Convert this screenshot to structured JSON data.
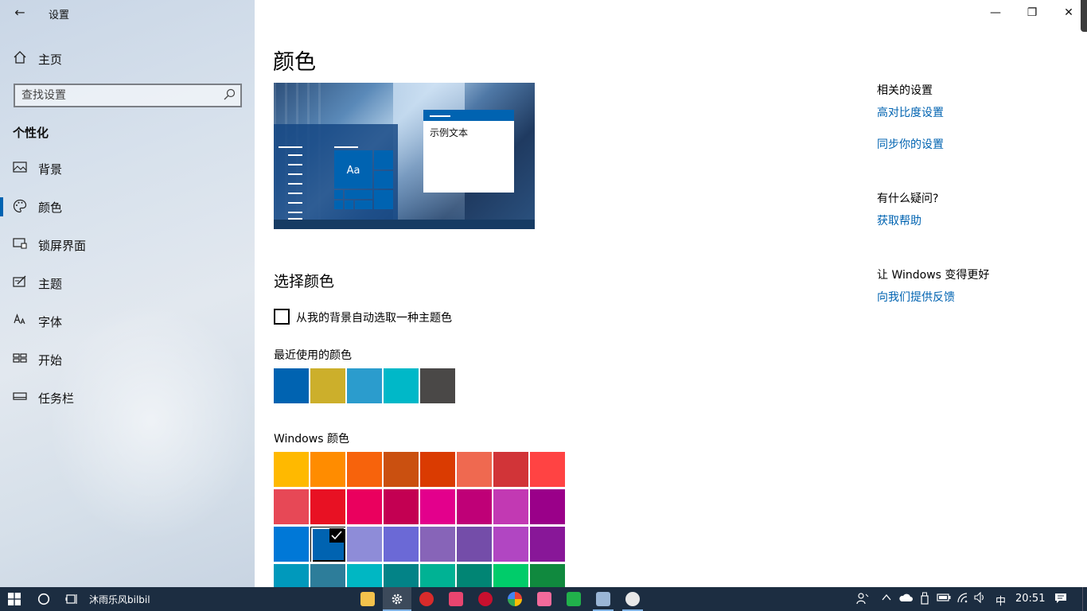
{
  "window": {
    "title": "设置",
    "back_glyph": "←",
    "minimize_glyph": "—",
    "restore_glyph": "❐",
    "close_glyph": "✕"
  },
  "sidebar": {
    "home_label": "主页",
    "search_placeholder": "查找设置",
    "section_title": "个性化",
    "items": [
      {
        "label": "背景",
        "icon": "image-icon",
        "selected": false
      },
      {
        "label": "颜色",
        "icon": "palette-icon",
        "selected": true
      },
      {
        "label": "锁屏界面",
        "icon": "lock-screen-icon",
        "selected": false
      },
      {
        "label": "主题",
        "icon": "theme-icon",
        "selected": false
      },
      {
        "label": "字体",
        "icon": "font-icon",
        "selected": false
      },
      {
        "label": "开始",
        "icon": "start-icon",
        "selected": false
      },
      {
        "label": "任务栏",
        "icon": "taskbar-icon",
        "selected": false
      }
    ]
  },
  "main": {
    "page_title": "颜色",
    "preview_tile_label": "Aa",
    "preview_sample_text": "示例文本",
    "choose_heading": "选择颜色",
    "auto_pick_label": "从我的背景自动选取一种主题色",
    "auto_pick_checked": false,
    "recent_heading": "最近使用的颜色",
    "recent_colors": [
      "#0063b1",
      "#ccaf2b",
      "#2b9ccd",
      "#00b8c8",
      "#4a4847"
    ],
    "windows_heading": "Windows 颜色",
    "windows_colors": [
      [
        "#ffb900",
        "#ff8c00",
        "#f7630c",
        "#ca5010",
        "#da3b01",
        "#ef6950",
        "#d13438",
        "#ff4343"
      ],
      [
        "#e74856",
        "#e81123",
        "#ea005e",
        "#c30052",
        "#e3008c",
        "#bf0077",
        "#c239b3",
        "#9a0089"
      ],
      [
        "#0078d7",
        "#0063b1",
        "#8e8cd8",
        "#6b69d6",
        "#8764b8",
        "#744da9",
        "#b146c2",
        "#881798"
      ],
      [
        "#0099bc",
        "#2d7d9a",
        "#00b7c3",
        "#038387",
        "#00b294",
        "#018574",
        "#00cc6a",
        "#10893e"
      ]
    ],
    "selected_color": "#0063b1"
  },
  "related": {
    "related_heading": "相关的设置",
    "high_contrast_link": "高对比度设置",
    "sync_link": "同步你的设置",
    "question_heading": "有什么疑问?",
    "help_link": "获取帮助",
    "better_heading": "让 Windows 变得更好",
    "feedback_link": "向我们提供反馈"
  },
  "taskbar": {
    "running_label": "沐雨乐风bilbil",
    "time": "20:51",
    "ime": "中",
    "accent": "#1c2d41"
  }
}
